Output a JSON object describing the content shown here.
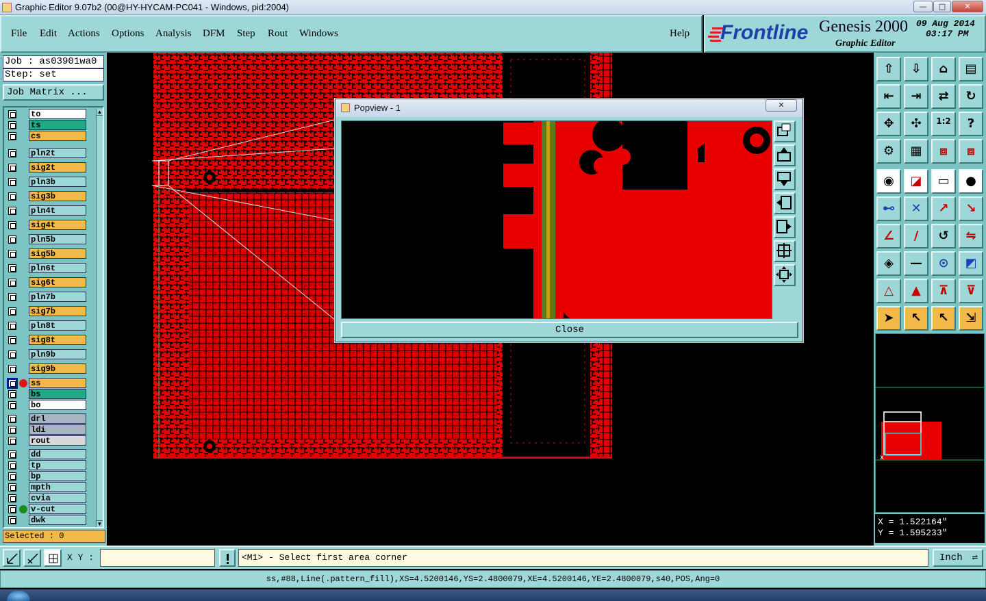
{
  "window": {
    "title": "Graphic Editor 9.07b2 (00@HY-HYCAM-PC041 - Windows, pid:2004)",
    "min_label": "—",
    "max_label": "□",
    "close_label": "✕"
  },
  "menu": {
    "items": [
      "File",
      "Edit",
      "Actions",
      "Options",
      "Analysis",
      "DFM",
      "Step",
      "Rout",
      "Windows"
    ],
    "help": "Help"
  },
  "brand": {
    "logo": "Frontline",
    "product": "Genesis 2000",
    "subtitle": "Graphic Editor",
    "date": "09  Aug  2014",
    "time": "03:17  PM"
  },
  "job": {
    "job_line": "Job : as03901wa0",
    "step_line": "Step: set",
    "matrix_button": "Job Matrix ..."
  },
  "layers": [
    {
      "name": "to",
      "color": "#ffffff"
    },
    {
      "name": "ts",
      "color": "#21a884"
    },
    {
      "name": "cs",
      "color": "#f2b84a"
    },
    {
      "name": "pln2t",
      "color": "#9ed7d7"
    },
    {
      "name": "sig2t",
      "color": "#f2b84a"
    },
    {
      "name": "pln3b",
      "color": "#9ed7d7"
    },
    {
      "name": "sig3b",
      "color": "#f2b84a"
    },
    {
      "name": "pln4t",
      "color": "#9ed7d7"
    },
    {
      "name": "sig4t",
      "color": "#f2b84a"
    },
    {
      "name": "pln5b",
      "color": "#9ed7d7"
    },
    {
      "name": "sig5b",
      "color": "#f2b84a"
    },
    {
      "name": "pln6t",
      "color": "#9ed7d7"
    },
    {
      "name": "sig6t",
      "color": "#f2b84a"
    },
    {
      "name": "pln7b",
      "color": "#9ed7d7"
    },
    {
      "name": "sig7b",
      "color": "#f2b84a"
    },
    {
      "name": "pln8t",
      "color": "#9ed7d7"
    },
    {
      "name": "sig8t",
      "color": "#f2b84a"
    },
    {
      "name": "pln9b",
      "color": "#9ed7d7"
    },
    {
      "name": "sig9b",
      "color": "#f2b84a"
    },
    {
      "name": "ss",
      "color": "#f2b84a",
      "active": true
    },
    {
      "name": "bs",
      "color": "#21a884"
    },
    {
      "name": "bo",
      "color": "#ffffff"
    },
    {
      "name": "drl",
      "color": "#a8b4c0"
    },
    {
      "name": "ldi",
      "color": "#a8b4c0"
    },
    {
      "name": "rout",
      "color": "#d8d8d8"
    },
    {
      "name": "dd",
      "color": "#9ed7d7"
    },
    {
      "name": "tp",
      "color": "#9ed7d7"
    },
    {
      "name": "bp",
      "color": "#9ed7d7"
    },
    {
      "name": "mpth",
      "color": "#9ed7d7"
    },
    {
      "name": "cvia",
      "color": "#9ed7d7"
    },
    {
      "name": "v-cut",
      "color": "#9ed7d7",
      "green": true
    },
    {
      "name": "dwk",
      "color": "#9ed7d7"
    }
  ],
  "selected_text": "Selected : 0",
  "popview": {
    "title": "Popview - 1",
    "close_label": "Close",
    "x_label": "✕"
  },
  "coords": {
    "x": "X  =  1.522164\"",
    "y": "Y  =  1.595233\""
  },
  "command": {
    "xy_label": "X Y :",
    "xy_value": "",
    "prompt": "<M1> - Select first area corner",
    "units": "Inch"
  },
  "status_line": "ss,#88,Line(.pattern_fill),XS=4.5200146,YS=2.4800079,XE=4.5200146,YE=2.4800079,s40,POS,Ang=0"
}
